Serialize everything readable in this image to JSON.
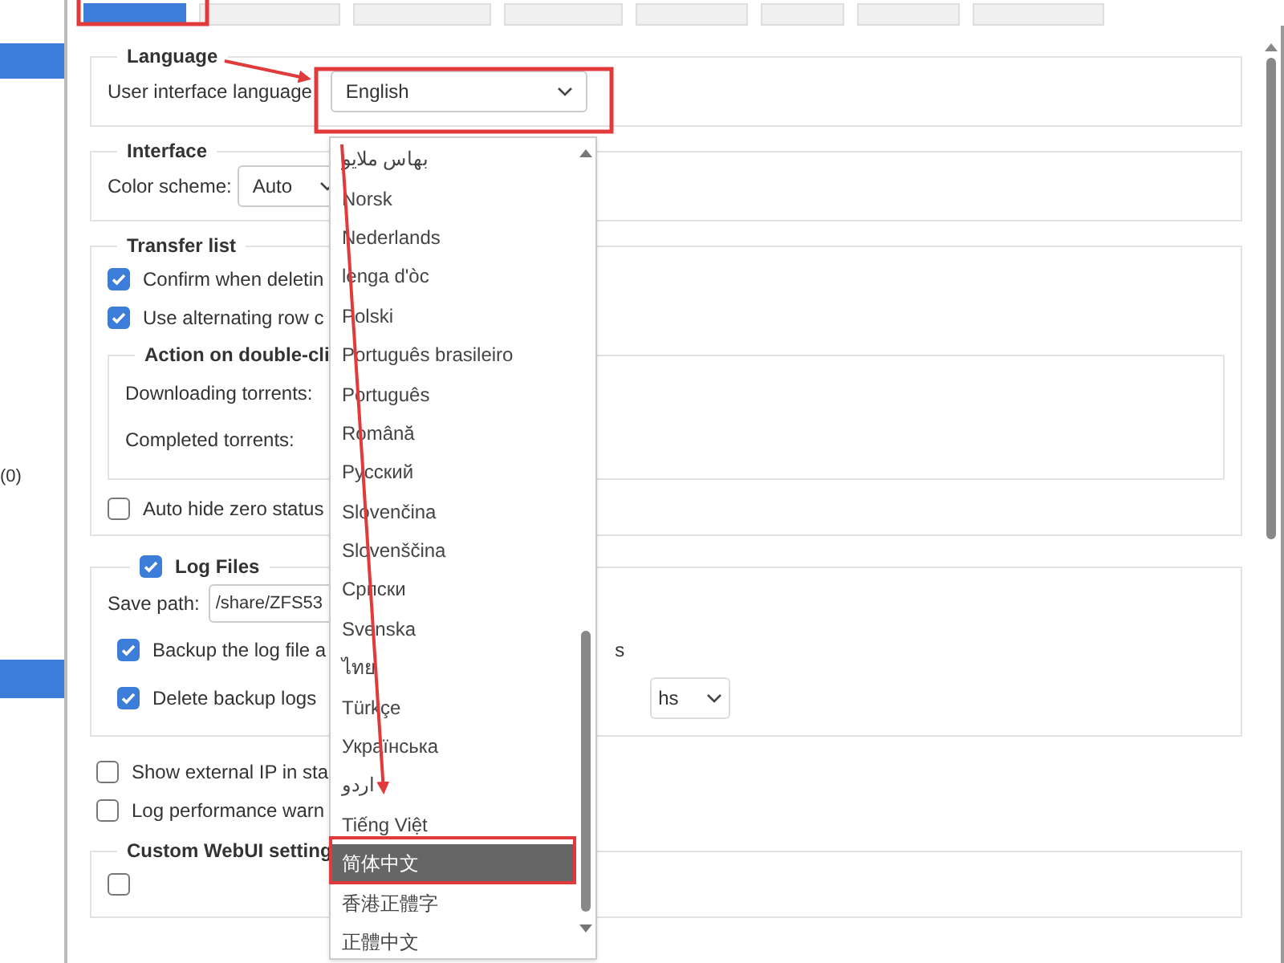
{
  "sidebar": {
    "count": "(0)"
  },
  "tabs": [
    {
      "selected": true
    },
    {
      "selected": false
    },
    {
      "selected": false
    },
    {
      "selected": false
    },
    {
      "selected": false
    },
    {
      "selected": false
    },
    {
      "selected": false
    },
    {
      "selected": false
    }
  ],
  "language": {
    "title": "Language",
    "label": "User interface language",
    "value": "English"
  },
  "interface": {
    "title": "Interface",
    "label": "Color scheme:",
    "value": "Auto"
  },
  "transfer_list": {
    "title": "Transfer list",
    "options": [
      {
        "label": "Confirm when deletin",
        "checked": true
      },
      {
        "label": "Use alternating row c",
        "checked": true
      }
    ],
    "double_click": {
      "title": "Action on double-cli",
      "rows": [
        "Downloading torrents:",
        "Completed torrents:"
      ]
    },
    "auto_hide": {
      "label": "Auto hide zero status",
      "checked": false
    }
  },
  "log_files": {
    "title": "Log Files",
    "checked": true,
    "save_label": "Save path:",
    "save_value": "/share/ZFS53",
    "options": [
      {
        "label": "Backup the log file a",
        "tail": "s",
        "checked": true
      },
      {
        "label": "Delete backup logs",
        "select_value": "hs",
        "checked": true
      }
    ]
  },
  "options": [
    {
      "label": "Show external IP in sta",
      "checked": false
    },
    {
      "label": "Log performance warn",
      "checked": false
    }
  ],
  "custom_webui": {
    "title": "Custom WebUI setting",
    "options": [
      {
        "checked": false
      }
    ]
  },
  "language_menu": {
    "options": [
      {
        "label": "بهاس ملايو",
        "selected": false
      },
      {
        "label": "Norsk",
        "selected": false
      },
      {
        "label": "Nederlands",
        "selected": false
      },
      {
        "label": "lenga d'òc",
        "selected": false
      },
      {
        "label": "Polski",
        "selected": false
      },
      {
        "label": "Português brasileiro",
        "selected": false
      },
      {
        "label": "Português",
        "selected": false
      },
      {
        "label": "Română",
        "selected": false
      },
      {
        "label": "Русский",
        "selected": false
      },
      {
        "label": "Slovenčina",
        "selected": false
      },
      {
        "label": "Slovenščina",
        "selected": false
      },
      {
        "label": "Српски",
        "selected": false
      },
      {
        "label": "Svenska",
        "selected": false
      },
      {
        "label": "ไทย",
        "selected": false
      },
      {
        "label": "Türkçe",
        "selected": false
      },
      {
        "label": "Українська",
        "selected": false
      },
      {
        "label": "اردو",
        "selected": false
      },
      {
        "label": "Tiếng Việt",
        "selected": false
      },
      {
        "label": "简体中文",
        "selected": true
      },
      {
        "label": "香港正體字",
        "selected": false
      },
      {
        "label": "正體中文",
        "selected": false
      }
    ]
  }
}
